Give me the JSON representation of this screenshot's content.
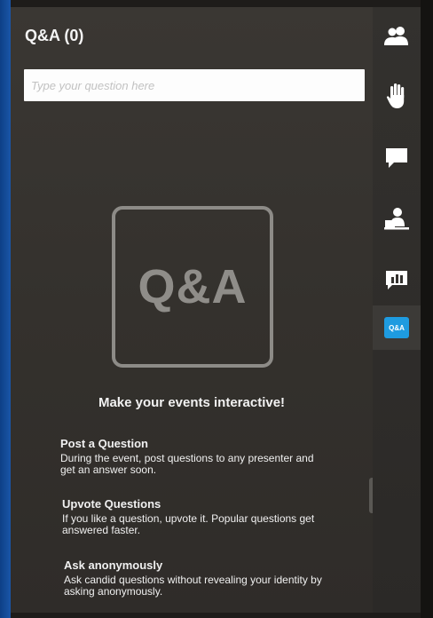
{
  "panel": {
    "title": "Q&A (0)",
    "search": {
      "placeholder": "Type your question here",
      "value": ""
    }
  },
  "promo": {
    "logo_text": "Q&A",
    "headline": "Make your events interactive!",
    "features": [
      {
        "title": "Post a Question",
        "description": "During the event, post questions to any presenter and get an answer soon."
      },
      {
        "title": "Upvote Questions",
        "description": "If you like a question, upvote it. Popular questions get answered faster."
      },
      {
        "title": "Ask anonymously",
        "description": "Ask candid questions without revealing your identity by asking anonymously."
      }
    ]
  },
  "collapse": {
    "glyph": "›"
  },
  "sidebar": {
    "items": [
      {
        "icon": "people-icon"
      },
      {
        "icon": "raise-hand-icon"
      },
      {
        "icon": "chat-icon"
      },
      {
        "icon": "presenter-icon"
      },
      {
        "icon": "poll-icon"
      },
      {
        "icon": "qa-icon",
        "label": "Q&A",
        "active": true
      }
    ]
  },
  "colors": {
    "active_badge": "#1e9be0",
    "panel_bg": "#36332f",
    "icon": "#ffffff"
  }
}
